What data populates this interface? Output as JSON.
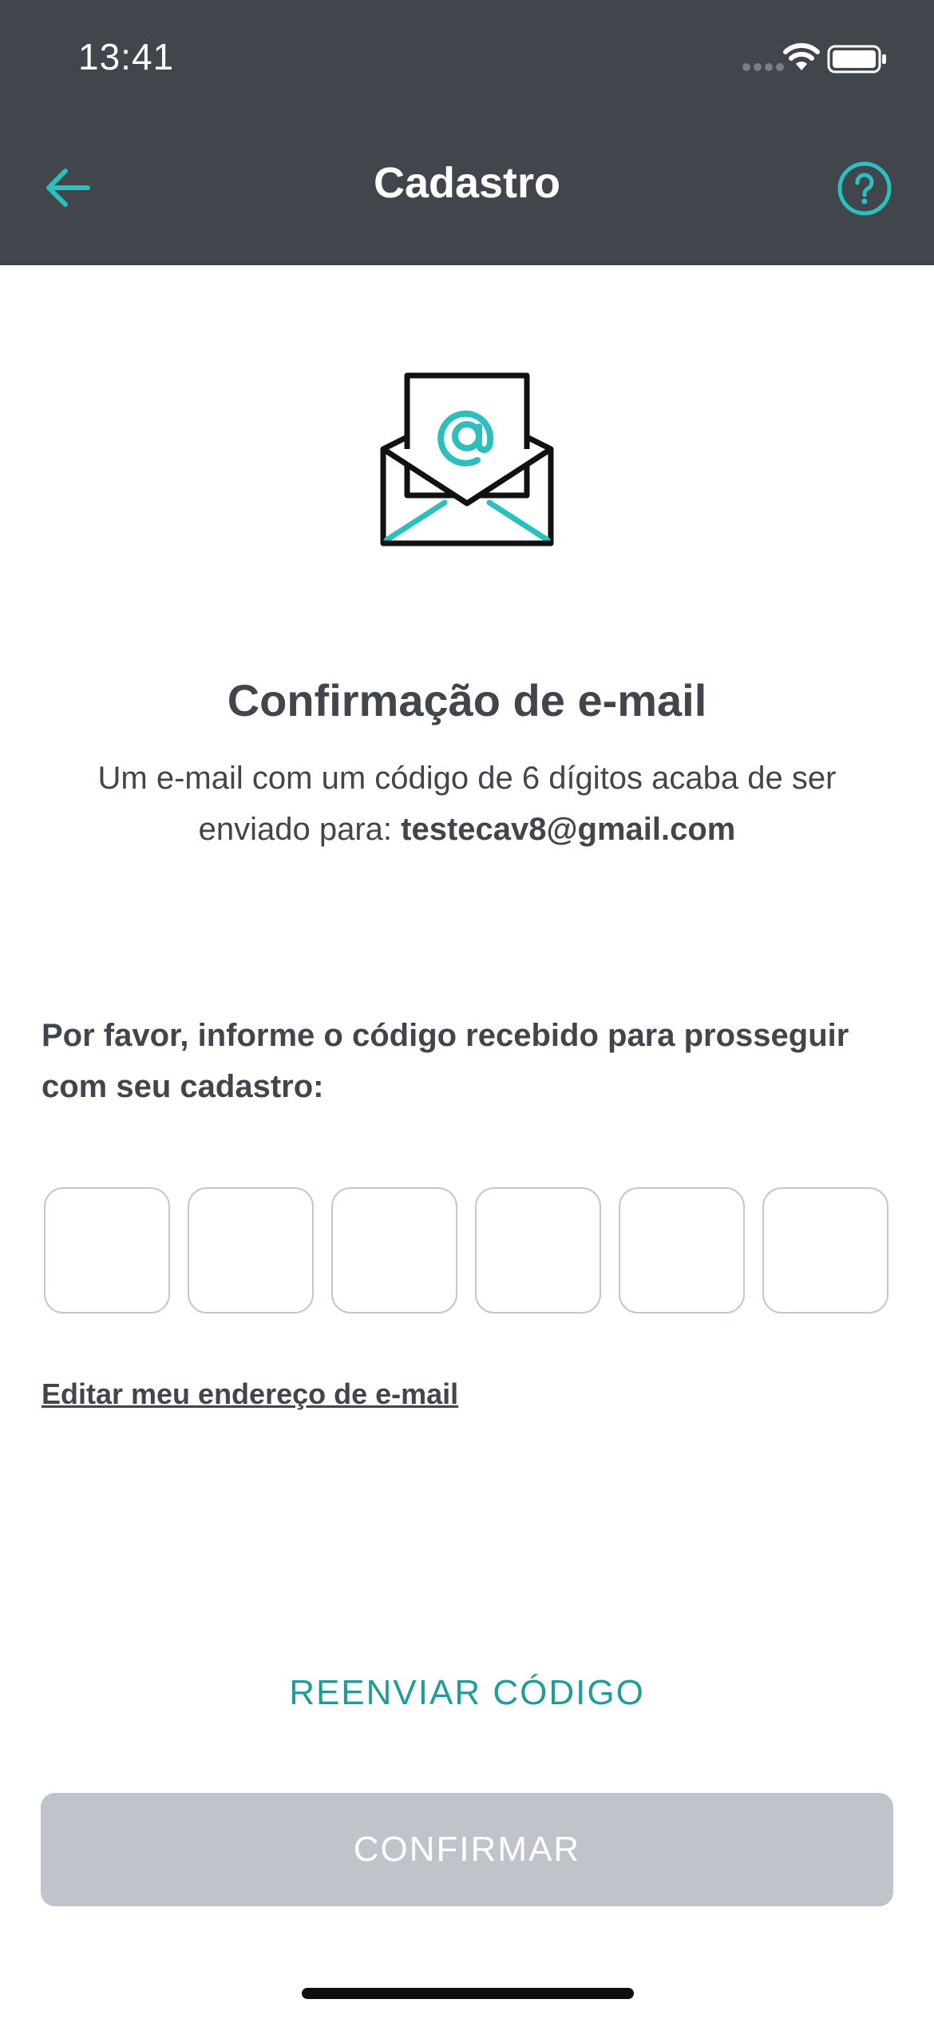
{
  "status_bar": {
    "time": "13:41"
  },
  "header": {
    "title": "Cadastro"
  },
  "confirmation": {
    "title": "Confirmação de e-mail",
    "description_prefix": "Um e-mail com um código de 6 dígitos acaba de ser enviado para: ",
    "email": "testecav8@gmail.com"
  },
  "prompt": "Por favor, informe o código recebido para prosseguir com seu cadastro:",
  "code_boxes": [
    "",
    "",
    "",
    "",
    "",
    ""
  ],
  "edit_link": "Editar meu endereço de e-mail",
  "resend_label": "REENVIAR CÓDIGO",
  "confirm_label": "CONFIRMAR",
  "colors": {
    "header_bg": "#40464c",
    "accent": "#2bbfc0",
    "text": "#40464c",
    "button_disabled": "#bec4ca"
  }
}
